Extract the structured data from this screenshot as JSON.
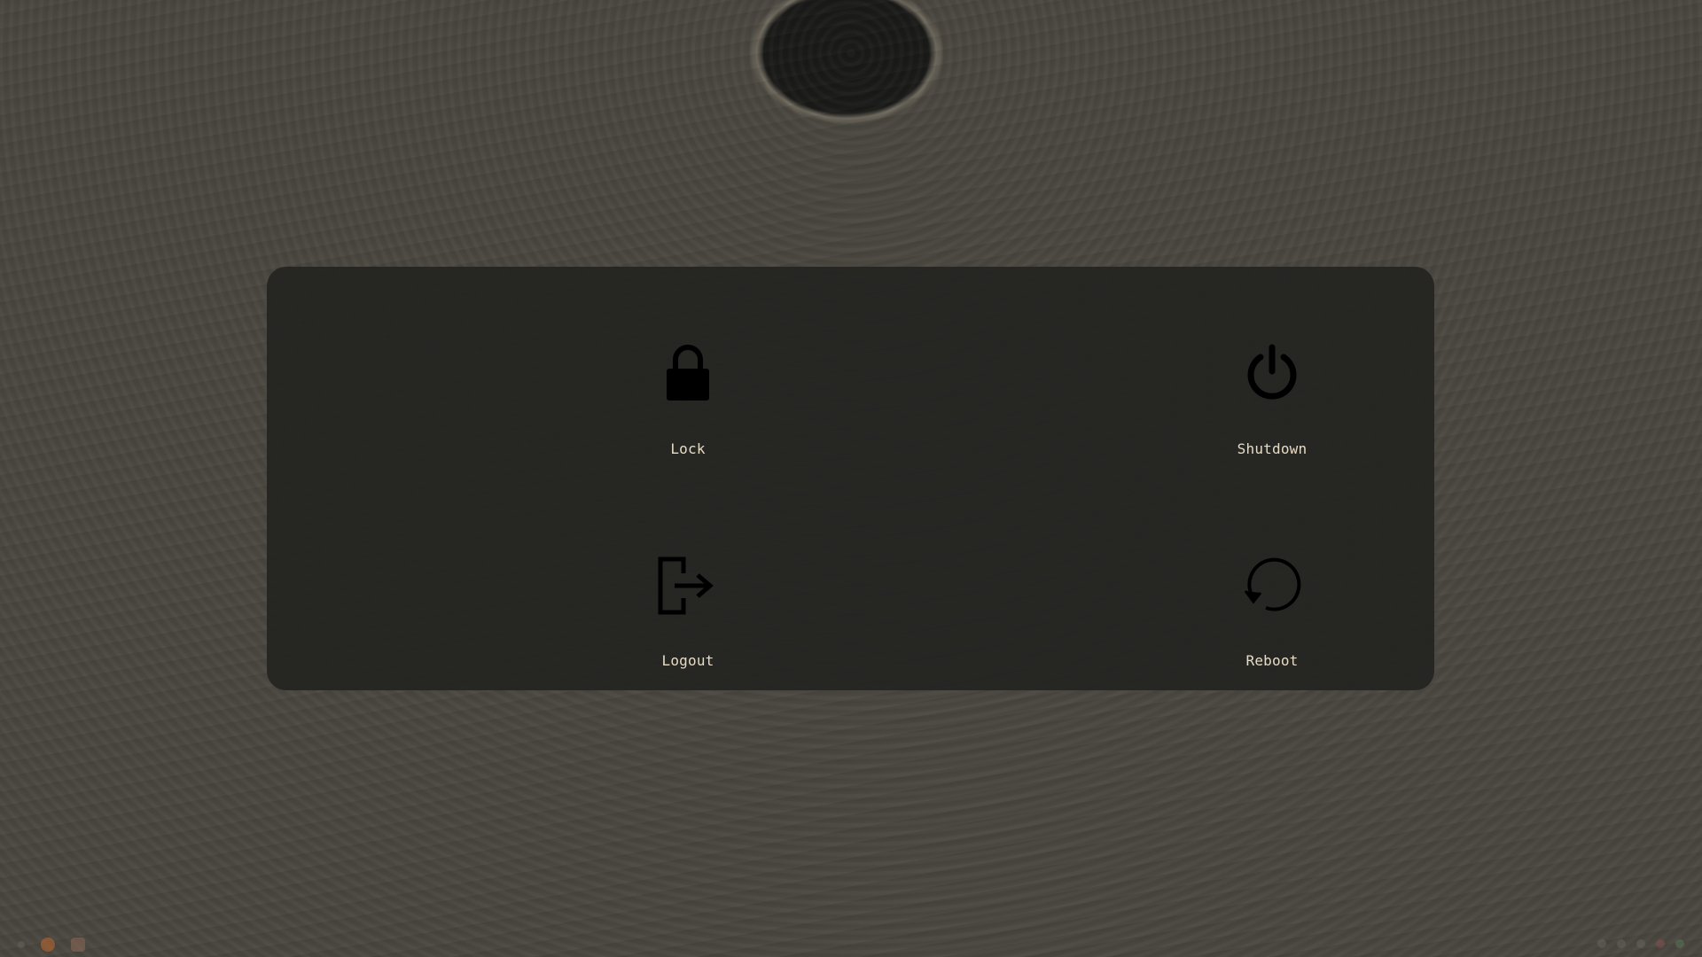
{
  "power_menu": {
    "actions": [
      {
        "id": "lock",
        "label": "Lock",
        "icon": "lock-icon"
      },
      {
        "id": "shutdown",
        "label": "Shutdown",
        "icon": "power-icon"
      },
      {
        "id": "logout",
        "label": "Logout",
        "icon": "logout-icon"
      },
      {
        "id": "reboot",
        "label": "Reboot",
        "icon": "reboot-icon"
      }
    ]
  },
  "colors": {
    "overlay_bg": "#242321",
    "label_text": "#e6dcc4",
    "icon": "#000000"
  }
}
